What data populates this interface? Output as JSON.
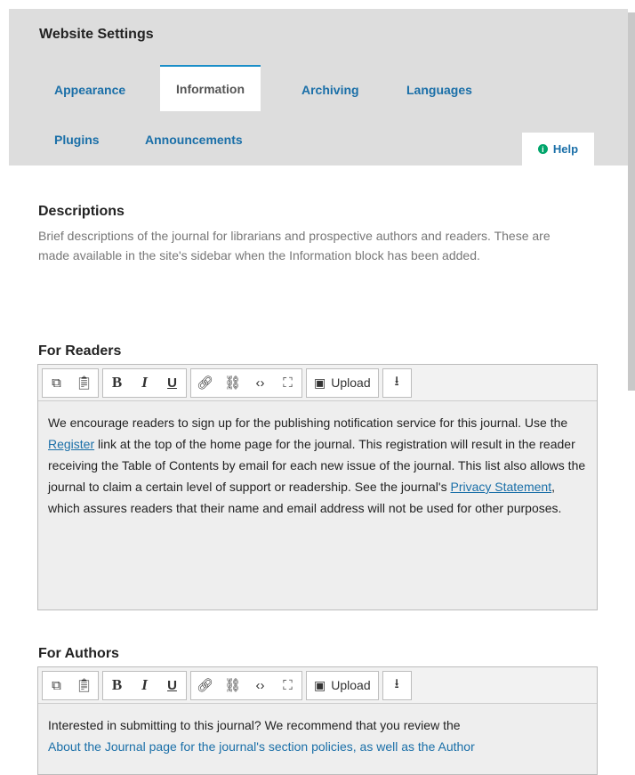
{
  "header": {
    "title": "Website Settings",
    "tabs": [
      "Appearance",
      "Information",
      "Archiving",
      "Languages",
      "Plugins",
      "Announcements"
    ],
    "active_tab": "Information",
    "help_label": "Help"
  },
  "descriptions": {
    "title": "Descriptions",
    "text": "Brief descriptions of the journal for librarians and prospective authors and readers. These are made available in the site's sidebar when the Information block has been added."
  },
  "toolbar": {
    "upload_label": "Upload",
    "buttons": [
      "copy-icon",
      "paste-icon",
      "bold-icon",
      "italic-icon",
      "underline-icon",
      "link-icon",
      "unlink-icon",
      "code-icon",
      "fullscreen-icon",
      "image-icon",
      "upload-file-icon"
    ]
  },
  "for_readers": {
    "label": "For Readers",
    "text_1": "We encourage readers to sign up for the publishing notification service for this journal. Use the ",
    "link_1": "Register",
    "text_2": " link at the top of the home page for the journal. This registration will result in the reader receiving the Table of Contents by email for each new issue of the journal. This list also allows the journal to claim a certain level of support or readership. See the journal's ",
    "link_2": "Privacy Statement",
    "text_3": ", which assures readers that their name and email address will not be used for other purposes."
  },
  "for_authors": {
    "label": "For Authors",
    "text_1": "Interested in submitting to this journal? We recommend that you review the",
    "text_2": "About the Journal page for the journal's section policies, as well as the Author"
  },
  "colors": {
    "accent": "#1a6fa8",
    "header_bg": "#dddddd",
    "help_icon": "#00a56b"
  }
}
